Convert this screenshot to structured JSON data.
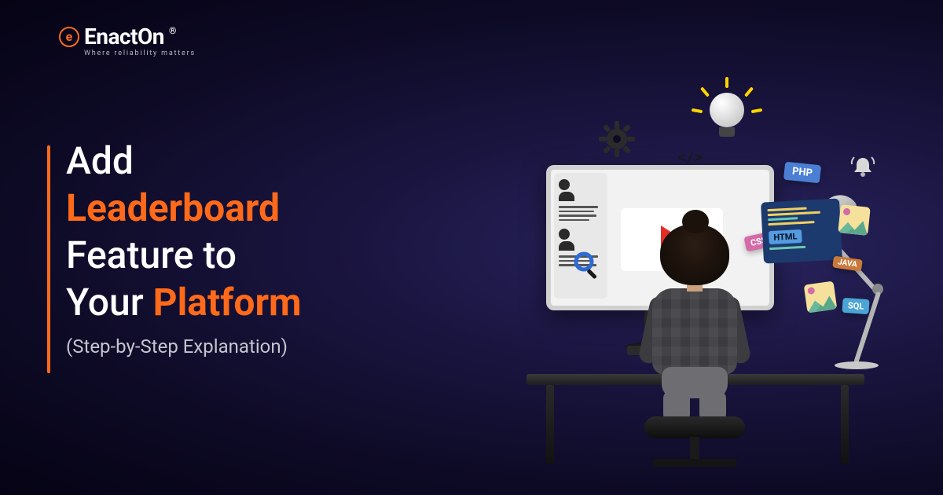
{
  "brand": {
    "mark_letter": "e",
    "name": "EnactOn",
    "registered": "®",
    "tagline": "Where reliability matters"
  },
  "headline": {
    "line1": "Add",
    "line2_orange": "Leaderboard",
    "line3": "Feature to",
    "line4_a": "Your ",
    "line4_b_orange": "Platform",
    "subtitle": "(Step-by-Step Explanation)"
  },
  "illustration": {
    "code_symbol": "</>",
    "tags": {
      "php": "PHP",
      "css": "CSS",
      "html": "HTML",
      "java": "JAVA",
      "sql": "SQL"
    }
  },
  "colors": {
    "accent": "#ff6a1a",
    "bg_deep": "#0d0a25"
  }
}
